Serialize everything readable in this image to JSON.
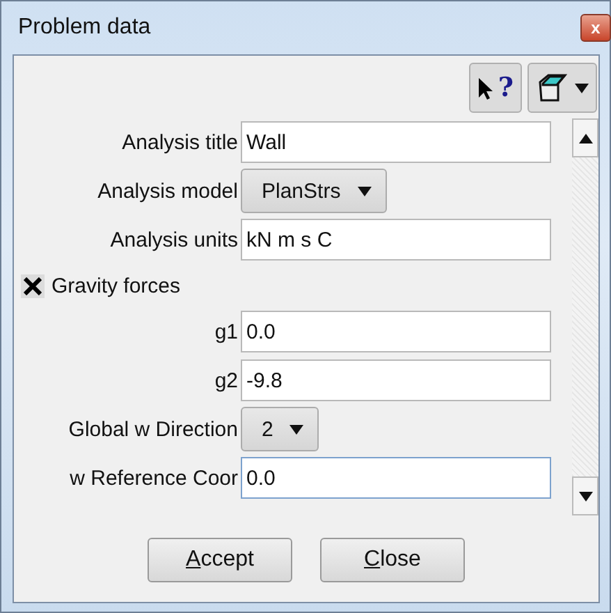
{
  "window": {
    "title": "Problem data",
    "close": "x"
  },
  "toolbar": {
    "help": "?"
  },
  "fields": [
    {
      "kind": "text",
      "label": "Analysis title",
      "value": "Wall"
    },
    {
      "kind": "select",
      "label": "Analysis model",
      "value": "PlanStrs"
    },
    {
      "kind": "text",
      "label": "Analysis units",
      "value": "kN m s C"
    },
    {
      "kind": "checkbox",
      "label": "Gravity forces",
      "checked": true
    },
    {
      "kind": "text",
      "label": "g1",
      "value": "0.0"
    },
    {
      "kind": "text",
      "label": "g2",
      "value": "-9.8"
    },
    {
      "kind": "select",
      "label": "Global w Direction",
      "value": "2"
    },
    {
      "kind": "text",
      "label": "w Reference Coor",
      "value": "0.0",
      "focused": true
    }
  ],
  "buttons": [
    {
      "label": "Accept"
    },
    {
      "label": "Close"
    }
  ]
}
